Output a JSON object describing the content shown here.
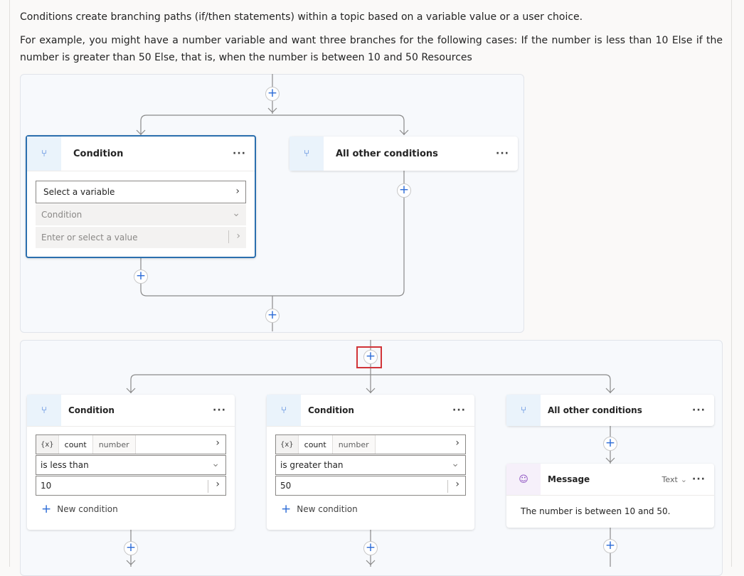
{
  "intro": {
    "p1": "Conditions create branching paths (if/then statements) within a topic based on a variable value or a user choice.",
    "p2": "For example, you might have a number variable and want three branches for the following cases: If the number is less than 10 Else if the number is greater than 50 Else, that is, when the number is between 10 and 50 Resources"
  },
  "diagram1": {
    "condition": {
      "title": "Condition",
      "more": "···",
      "variable_placeholder": "Select a variable",
      "operator_placeholder": "Condition",
      "value_placeholder": "Enter or select a value"
    },
    "other": {
      "title": "All other conditions",
      "more": "···"
    }
  },
  "diagram2": {
    "cond1": {
      "title": "Condition",
      "more": "···",
      "var_symbol": "{x}",
      "var_name": "count",
      "var_type": "number",
      "operator": "is less than",
      "value": "10",
      "new_condition": "New condition"
    },
    "cond2": {
      "title": "Condition",
      "more": "···",
      "var_symbol": "{x}",
      "var_name": "count",
      "var_type": "number",
      "operator": "is greater than",
      "value": "50",
      "new_condition": "New condition"
    },
    "other": {
      "title": "All other conditions",
      "more": "···"
    },
    "message": {
      "title": "Message",
      "format": "Text",
      "more": "···",
      "text": "The number is between 10 and 50."
    }
  },
  "icons": {
    "plus": "+",
    "branch": "⑂",
    "chevron_right": "›",
    "chevron_down": "⌄",
    "message": "☺"
  },
  "colors": {
    "accent": "#2b6bd6",
    "selected_border": "#2b6fae",
    "highlight": "#d13438"
  }
}
